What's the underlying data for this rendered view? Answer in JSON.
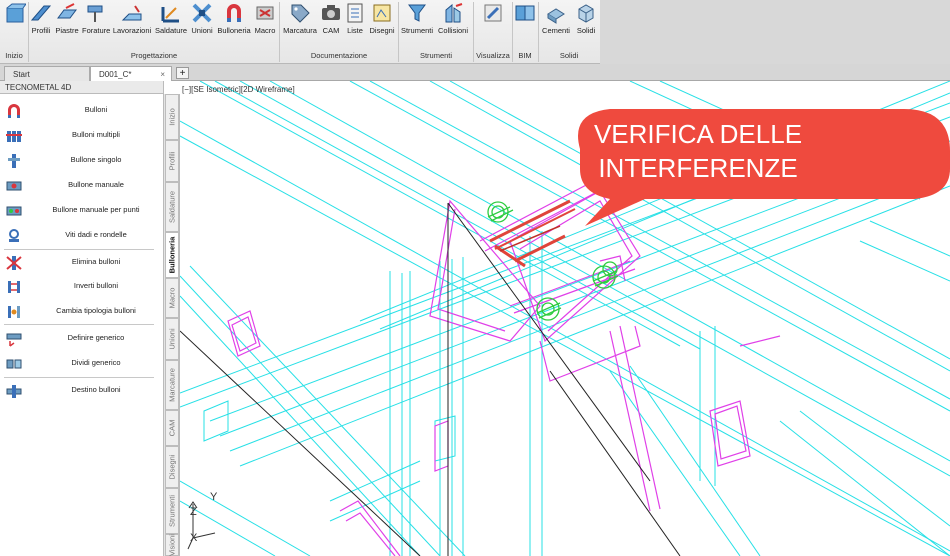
{
  "ribbon": {
    "groups": [
      {
        "label": "Inizio",
        "items": [
          ""
        ]
      },
      {
        "label": "Progettazione",
        "items": [
          "Profili",
          "Piastre",
          "Forature",
          "Lavorazioni",
          "Saldature",
          "Unioni",
          "Bulloneria",
          "Macro"
        ]
      },
      {
        "label": "Documentazione",
        "items": [
          "Marcatura",
          "CAM",
          "Liste",
          "Disegni"
        ]
      },
      {
        "label": "Strumenti",
        "items": [
          "Strumenti",
          "Collisioni"
        ]
      },
      {
        "label": "Visualizza",
        "items": [
          ""
        ]
      },
      {
        "label": "BIM",
        "items": [
          ""
        ]
      },
      {
        "label": "Solidi",
        "items": [
          "Cementi",
          "Solidi"
        ]
      }
    ]
  },
  "tabs": [
    {
      "label": "Start"
    },
    {
      "label": "D001_C*",
      "close": "×"
    }
  ],
  "tab_add": "+",
  "palette": {
    "title": "TECNOMETAL 4D",
    "items": [
      "Bulloni",
      "Bulloni multipli",
      "Bullone singolo",
      "Bullone manuale",
      "Bullone manuale per punti",
      "Viti dadi e rondelle",
      "Elimina bulloni",
      "Inverti bulloni",
      "Cambia tipologia bulloni",
      "Definire generico",
      "Dividi generico",
      "Destino bulloni"
    ]
  },
  "vertical_tabs": [
    "Inizio",
    "Profili",
    "Saldature",
    "Bulloneria",
    "Macro",
    "Unioni",
    "Marcature",
    "CAM",
    "Disegni",
    "Strumenti",
    "Visioni"
  ],
  "viewport": {
    "label": "[−][SE Isometric][2D Wireframe]",
    "callout_line1": "VERIFICA DELLE",
    "callout_line2": "INTERFERENZE",
    "axis_y": "Y",
    "axis_z": "Z",
    "axis_x": "X"
  },
  "colors": {
    "cyan": "#27e0e6",
    "magenta": "#e040e8",
    "callout": "#ef4a3e",
    "bolt": "#2ecc40",
    "clash": "#e0443a"
  }
}
